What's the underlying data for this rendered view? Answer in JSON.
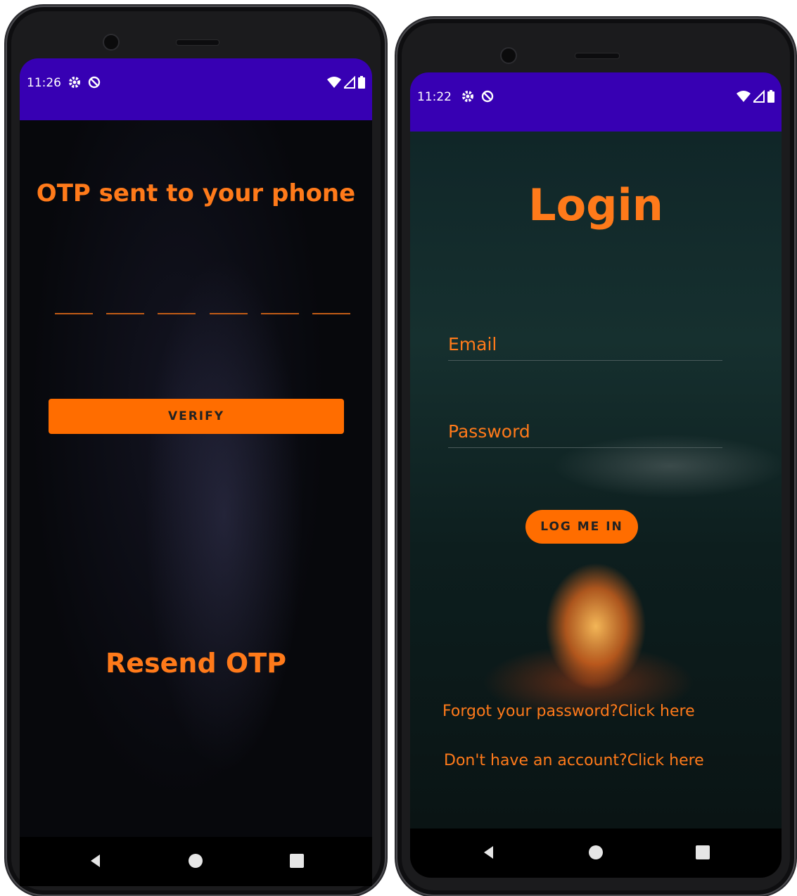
{
  "otp_screen": {
    "status_time": "11:26",
    "title": "OTP sent to your phone",
    "otp_slots": [
      "",
      "",
      "",
      "",
      "",
      ""
    ],
    "verify_label": "VERIFY",
    "resend_label": "Resend OTP"
  },
  "login_screen": {
    "status_time": "11:22",
    "title": "Login",
    "email_placeholder": "Email",
    "password_placeholder": "Password",
    "login_button_label": "LOG ME IN",
    "forgot_link": "Forgot your password?Click here",
    "signup_link": "Don't have an account?Click here"
  },
  "icons": {
    "status_left": [
      "gear-icon",
      "no-sim-icon"
    ],
    "status_right": [
      "wifi-icon",
      "signal-icon",
      "battery-icon"
    ],
    "nav": [
      "back-icon",
      "home-icon",
      "recents-icon"
    ]
  },
  "colors": {
    "status_bar": "#3700b3",
    "accent": "#ff6d00",
    "accent_text": "#ff7a1a"
  }
}
